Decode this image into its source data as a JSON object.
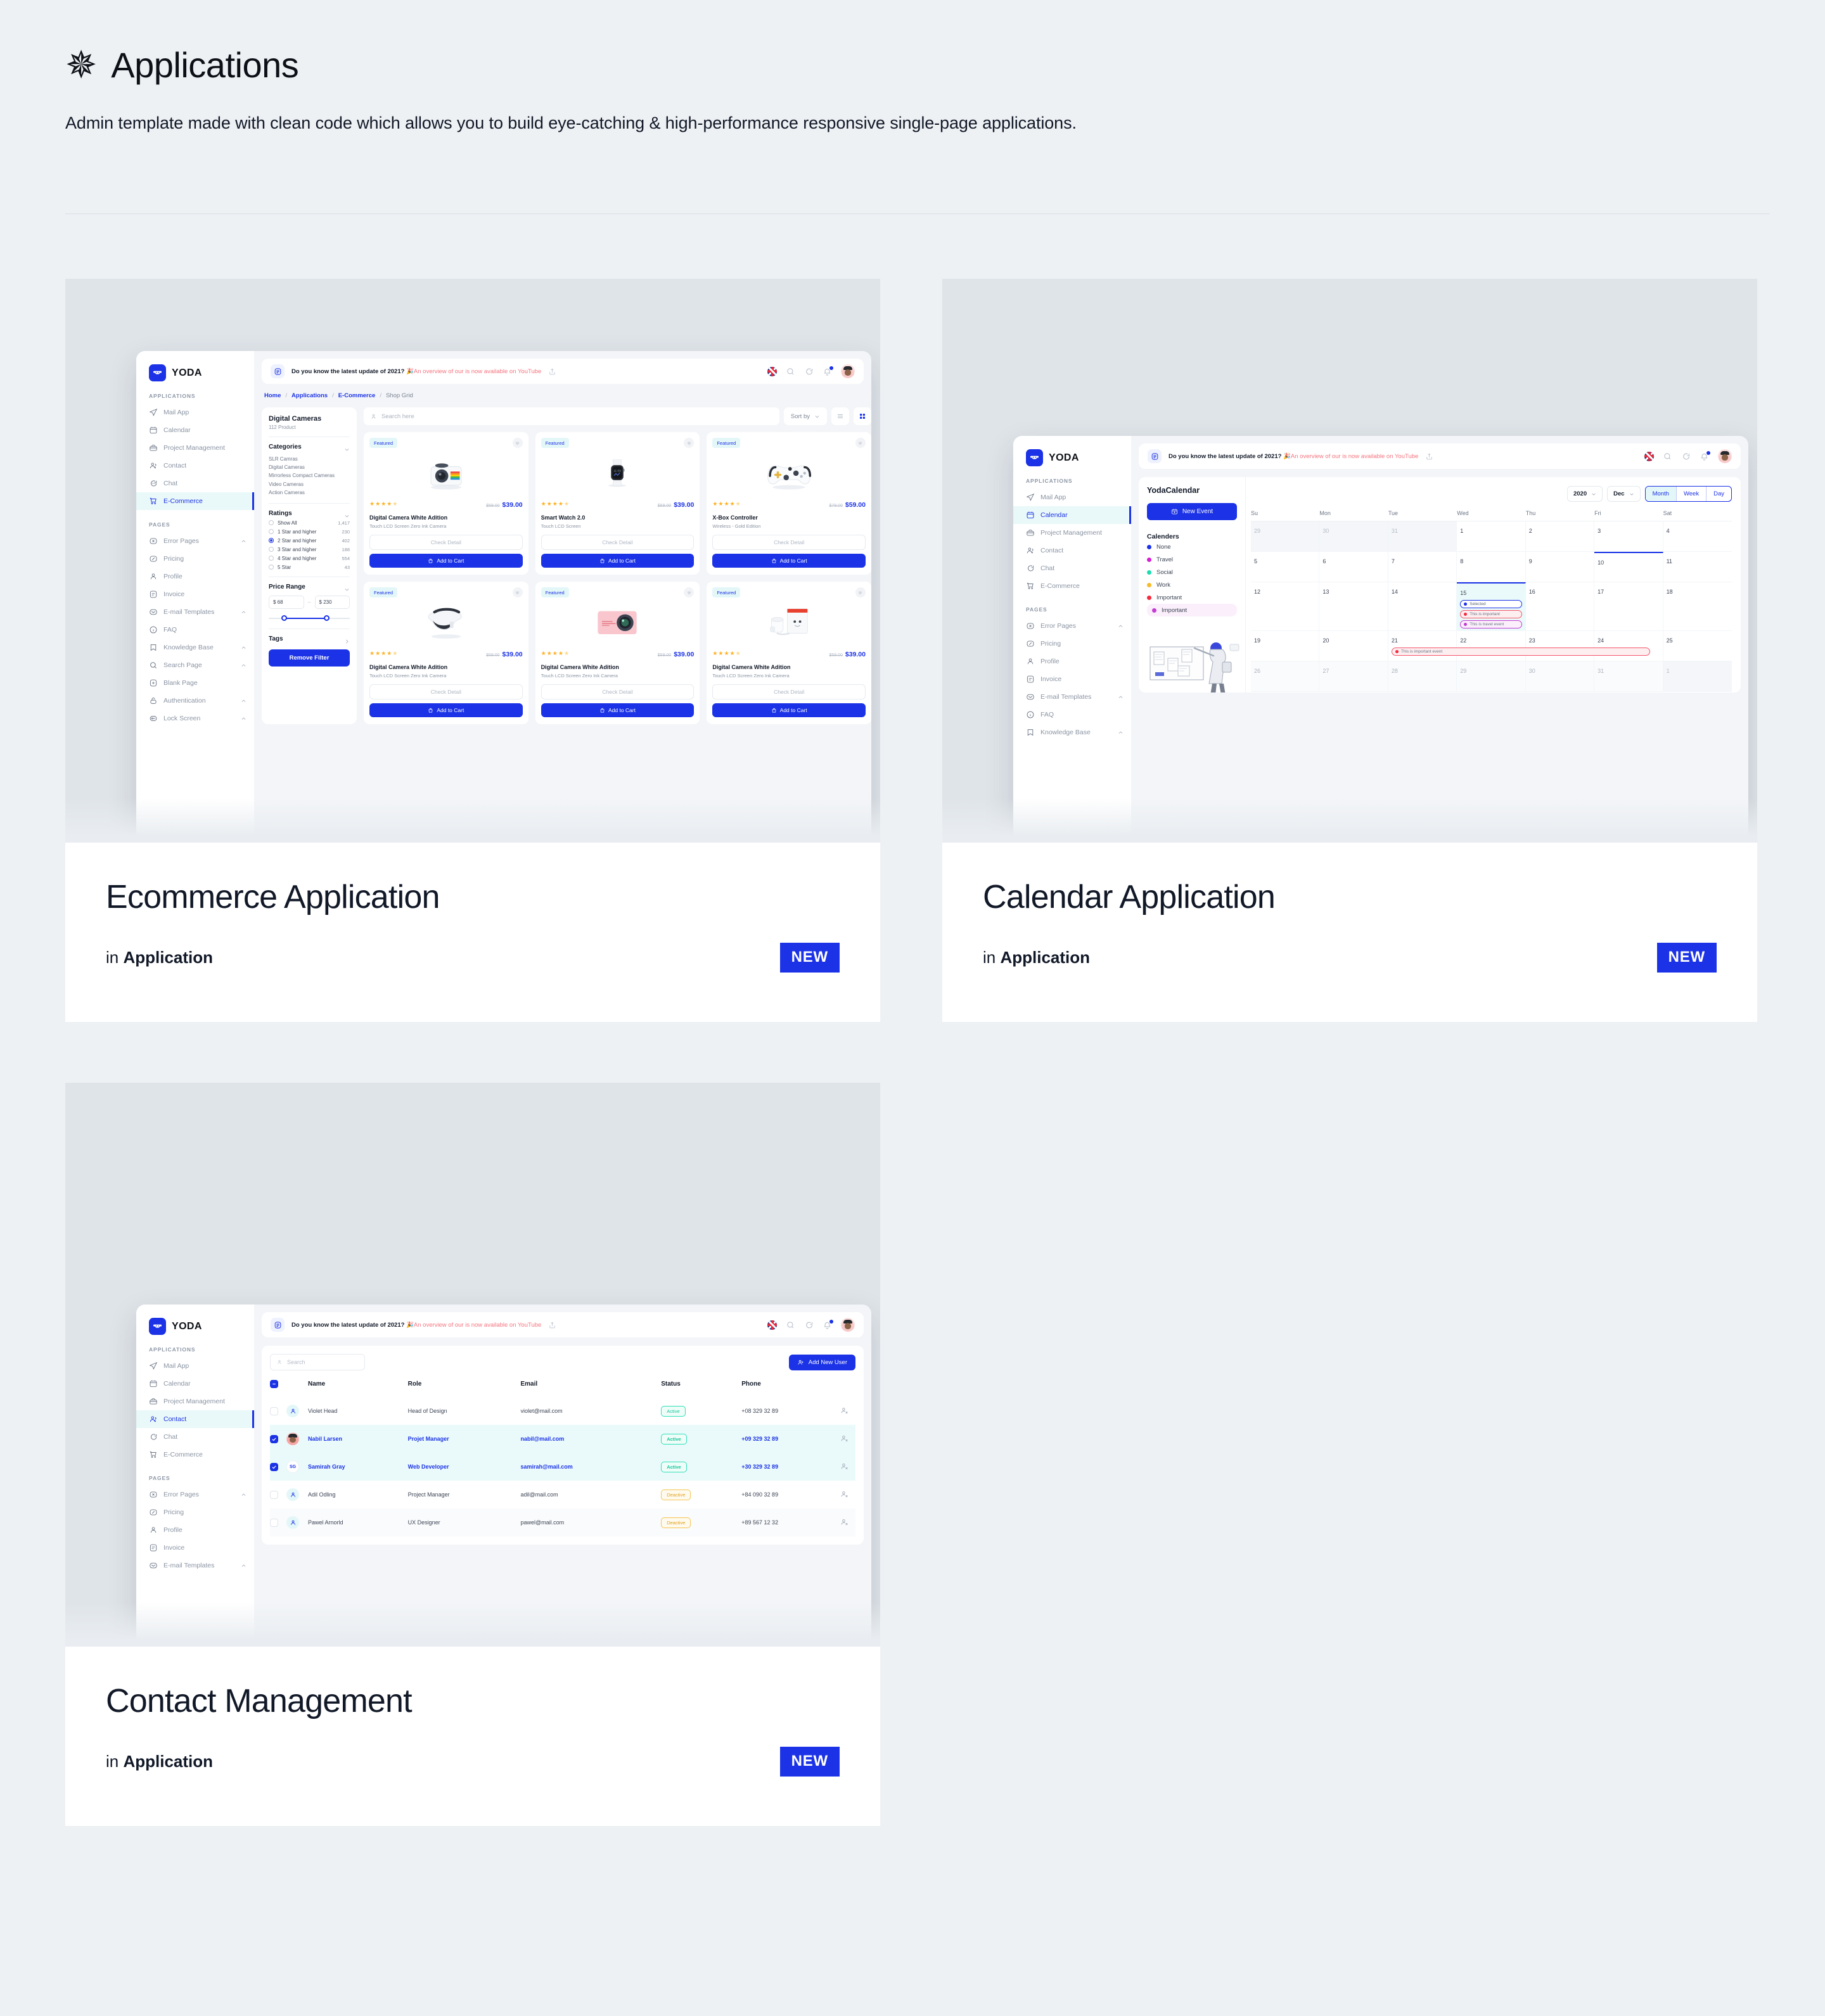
{
  "header": {
    "star_icon": "asterisk-icon",
    "title": "Applications",
    "subtitle": "Admin template made with clean code which allows you to build eye-catching & high-performance responsive single-page applications."
  },
  "colors": {
    "page_bg": "#eef1f4",
    "thumb_bg": "#dfe4e8",
    "accent": "#1b32e6",
    "badge_new_bg": "#1b32e6",
    "active_nav_bg": "#e9f8f8",
    "star": "#ffb01f",
    "status_active": "#17c79a",
    "status_deactive": "#e0a11c"
  },
  "cards": [
    {
      "title": "Ecommerce Application",
      "meta_prefix": "in",
      "meta_category": "Application",
      "badge": "NEW"
    },
    {
      "title": "Calendar Application",
      "meta_prefix": "in",
      "meta_category": "Application",
      "badge": "NEW"
    },
    {
      "title": "Contact Management",
      "meta_prefix": "in",
      "meta_category": "Application",
      "badge": "NEW"
    }
  ],
  "app": {
    "brand": "YODA",
    "topbar": {
      "message_bold": "Do you know the latest update of 2021?",
      "message_emoji": "🎉",
      "message_red": "An overview of our is now available on YouTube",
      "icons": [
        "flag-uk-icon",
        "search-icon",
        "chat-icon",
        "bell-icon",
        "avatar"
      ]
    },
    "sidebar": {
      "section_applications": "APPLICATIONS",
      "section_pages": "PAGES",
      "applications": [
        {
          "label": "Mail App",
          "icon": "send-icon"
        },
        {
          "label": "Calendar",
          "icon": "calendar-icon"
        },
        {
          "label": "Project Management",
          "icon": "briefcase-icon"
        },
        {
          "label": "Contact",
          "icon": "users-icon"
        },
        {
          "label": "Chat",
          "icon": "chat-bubble-icon"
        },
        {
          "label": "E-Commerce",
          "icon": "cart-icon"
        }
      ],
      "pages": [
        {
          "label": "Error Pages",
          "icon": "error-icon",
          "caret": true
        },
        {
          "label": "Pricing",
          "icon": "percent-icon",
          "caret": false
        },
        {
          "label": "Profile",
          "icon": "user-icon",
          "caret": false
        },
        {
          "label": "Invoice",
          "icon": "invoice-icon",
          "caret": false
        },
        {
          "label": "E-mail Templates",
          "icon": "envelope-icon",
          "caret": true
        },
        {
          "label": "FAQ",
          "icon": "info-icon",
          "caret": false
        },
        {
          "label": "Knowledge Base",
          "icon": "bookmark-icon",
          "caret": true
        },
        {
          "label": "Search Page",
          "icon": "search-icon",
          "caret": true
        },
        {
          "label": "Blank Page",
          "icon": "plus-doc-icon",
          "caret": false
        },
        {
          "label": "Authentication",
          "icon": "lock-open-icon",
          "caret": true
        },
        {
          "label": "Lock Screen",
          "icon": "key-icon",
          "caret": true
        }
      ]
    }
  },
  "ecommerce": {
    "breadcrumb": [
      "Home",
      "Applications",
      "E-Commerce",
      "Shop Grid"
    ],
    "filter": {
      "title": "Digital Cameras",
      "subtitle": "112 Product",
      "categories_label": "Categories",
      "categories": [
        "SLR Camras",
        "Digital Cameras",
        "Mirrorless Compact Cameras",
        "Video Cameras",
        "Action Cameras"
      ],
      "ratings_label": "Ratings",
      "ratings": [
        {
          "label": "Show All",
          "count": "1,417",
          "selected": false
        },
        {
          "label": "1 Star and higher",
          "count": "230",
          "selected": false
        },
        {
          "label": "2 Star and higher",
          "count": "402",
          "selected": true
        },
        {
          "label": "3 Star and higher",
          "count": "188",
          "selected": false
        },
        {
          "label": "4 Star and higher",
          "count": "554",
          "selected": false
        },
        {
          "label": "5 Star",
          "count": "43",
          "selected": false
        }
      ],
      "price_label": "Price Range",
      "price_min": "$ 68",
      "price_max": "$ 230",
      "tags_label": "Tags",
      "remove_filter": "Remove Filter"
    },
    "toolbar": {
      "search_placeholder": "Search here",
      "sort_label": "Sort by",
      "view_list_icon": "list-view-icon",
      "view_grid_icon": "grid-view-icon"
    },
    "products": [
      {
        "badge": "Featured",
        "name": "Digital Camera White Adition",
        "desc": "Touch LCD Screen Zero Ink Camera",
        "price_old": "$59.00",
        "price_new": "$39.00",
        "detail": "Check Detail",
        "cart": "Add to Cart",
        "image": "instant-camera"
      },
      {
        "badge": "Featured",
        "name": "Smart Watch 2.0",
        "desc": "Touch LCD Screen",
        "price_old": "$59.00",
        "price_new": "$39.00",
        "detail": "Check Detail",
        "cart": "Add to Cart",
        "image": "smart-watch"
      },
      {
        "badge": "Featured",
        "name": "X-Box Controller",
        "desc": "Wireless - Gold Edition",
        "price_old": "$79.00",
        "price_new": "$59.00",
        "detail": "Check Detail",
        "cart": "Add to Cart",
        "image": "game-controller"
      },
      {
        "badge": "Featured",
        "name": "Digital Camera White Adition",
        "desc": "Touch LCD Screen Zero Ink Camera",
        "price_old": "$59.00",
        "price_new": "$39.00",
        "detail": "Check Detail",
        "cart": "Add to Cart",
        "image": "vr-headset"
      },
      {
        "badge": "Featured",
        "name": "Digital Camera White Adition",
        "desc": "Touch LCD Screen Zero Ink Camera",
        "price_old": "$59.00",
        "price_new": "$39.00",
        "detail": "Check Detail",
        "cart": "Add to Cart",
        "image": "pink-action-camera"
      },
      {
        "badge": "Featured",
        "name": "Digital Camera White Adition",
        "desc": "Touch LCD Screen Zero Ink Camera",
        "price_old": "$59.00",
        "price_new": "$39.00",
        "detail": "Check Detail",
        "cart": "Add to Cart",
        "image": "smart-speaker-box"
      }
    ]
  },
  "calendar": {
    "title": "YodaCalendar",
    "new_event": "New Event",
    "calendars_label": "Calenders",
    "calendars": [
      {
        "label": "None",
        "color": "#1b32e6"
      },
      {
        "label": "Travel",
        "color": "#d41fd4"
      },
      {
        "label": "Social",
        "color": "#1ddbb0"
      },
      {
        "label": "Work",
        "color": "#f7bb2a"
      },
      {
        "label": "Important",
        "color": "#f42b3f"
      },
      {
        "label": "Important",
        "color": "#c33dd4",
        "highlight": true
      }
    ],
    "year": "2020",
    "month": "Dec",
    "views": [
      "Month",
      "Week",
      "Day"
    ],
    "active_view": "Month",
    "dow": [
      "Su",
      "Mon",
      "Tue",
      "Wed",
      "Thu",
      "Fri",
      "Sat"
    ],
    "weeks": [
      [
        {
          "n": "29",
          "out": true
        },
        {
          "n": "30",
          "out": true
        },
        {
          "n": "31",
          "out": true
        },
        {
          "n": "1"
        },
        {
          "n": "2"
        },
        {
          "n": "3",
          "today": true
        },
        {
          "n": "4"
        }
      ],
      [
        {
          "n": "5"
        },
        {
          "n": "6"
        },
        {
          "n": "7"
        },
        {
          "n": "8"
        },
        {
          "n": "9"
        },
        {
          "n": "10",
          "today": true
        },
        {
          "n": "11"
        }
      ],
      [
        {
          "n": "12"
        },
        {
          "n": "13"
        },
        {
          "n": "14"
        },
        {
          "n": "15",
          "selected": true,
          "events": [
            {
              "text": "Selected",
              "type": "blue",
              "color": "#1b32e6"
            },
            {
              "text": "This is important",
              "type": "red",
              "color": "#f42b3f"
            },
            {
              "text": "This is travel event",
              "type": "purple",
              "color": "#c33dd4"
            }
          ]
        },
        {
          "n": "16"
        },
        {
          "n": "17"
        },
        {
          "n": "18"
        }
      ],
      [
        {
          "n": "19"
        },
        {
          "n": "20"
        },
        {
          "n": "21",
          "wide_event": {
            "text": "This is important event",
            "type": "red",
            "color": "#f42b3f"
          }
        },
        {
          "n": "22"
        },
        {
          "n": "23"
        },
        {
          "n": "24"
        },
        {
          "n": "25"
        }
      ],
      [
        {
          "n": "26",
          "dim": true
        },
        {
          "n": "27",
          "dim": true
        },
        {
          "n": "28",
          "dim": true
        },
        {
          "n": "29",
          "dim": true
        },
        {
          "n": "30",
          "dim": true
        },
        {
          "n": "31",
          "dim": true
        },
        {
          "n": "1",
          "out": true
        }
      ]
    ]
  },
  "contact": {
    "search_placeholder": "Search",
    "add_button": "Add New User",
    "columns": [
      "Name",
      "Role",
      "Email",
      "Status",
      "Phone"
    ],
    "rows": [
      {
        "name": "Violet Head",
        "role": "Head of Design",
        "email": "violet@mail.com",
        "status": "Active",
        "phone": "+08 329 32 89",
        "checked": false,
        "avatar": "user-icon"
      },
      {
        "name": "Nabil Larsen",
        "role": "Projet Manager",
        "email": "nabil@mail.com",
        "status": "Active",
        "phone": "+09 329 32 89",
        "checked": true,
        "avatar": "photo"
      },
      {
        "name": "Samirah Gray",
        "role": "Web Developer",
        "email": "samirah@mail.com",
        "status": "Active",
        "phone": "+30 329 32 89",
        "checked": true,
        "avatar": "SG"
      },
      {
        "name": "Adil Odling",
        "role": "Project Manager",
        "email": "adil@mail.com",
        "status": "Deactive",
        "phone": "+84 090 32 89",
        "checked": false,
        "avatar": "user-icon"
      },
      {
        "name": "Pawel Arnorld",
        "role": "UX Designer",
        "email": "pawel@mail.com",
        "status": "Deactive",
        "phone": "+89 567 12 32",
        "checked": false,
        "avatar": "user-icon"
      }
    ]
  }
}
